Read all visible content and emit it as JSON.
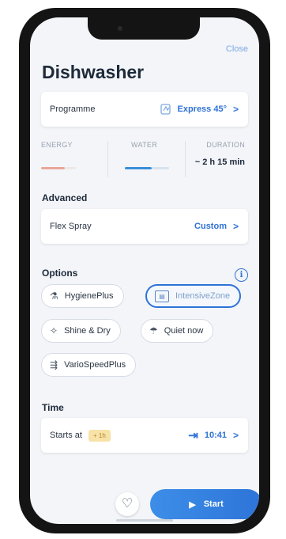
{
  "header": {
    "close_label": "Close",
    "title": "Dishwasher"
  },
  "programme": {
    "label": "Programme",
    "value": "Express 45°",
    "icon": "express-icon"
  },
  "stats": {
    "energy_label": "ENERGY",
    "water_label": "WATER",
    "duration_label": "DURATION",
    "duration_value": "~ 2 h 15 min",
    "energy_color": "#e9a79a",
    "water_color": "#3a8fd9"
  },
  "advanced": {
    "heading": "Advanced",
    "label": "Flex Spray",
    "value": "Custom"
  },
  "options": {
    "heading": "Options",
    "items": [
      {
        "label": "HygienePlus",
        "icon": "hygiene-icon",
        "selected": false
      },
      {
        "label": "IntensiveZone",
        "icon": "intensive-zone-icon",
        "selected": true
      },
      {
        "label": "Shine & Dry",
        "icon": "shine-dry-icon",
        "selected": false
      },
      {
        "label": "Quiet now",
        "icon": "quiet-icon",
        "selected": false
      },
      {
        "label": "VarioSpeedPlus",
        "icon": "vario-speed-icon",
        "selected": false
      }
    ]
  },
  "time": {
    "heading": "Time",
    "label": "Starts at",
    "badge": "+ 1h",
    "value": "10:41"
  },
  "actions": {
    "start_label": "Start",
    "accent": "#2f72d6"
  }
}
